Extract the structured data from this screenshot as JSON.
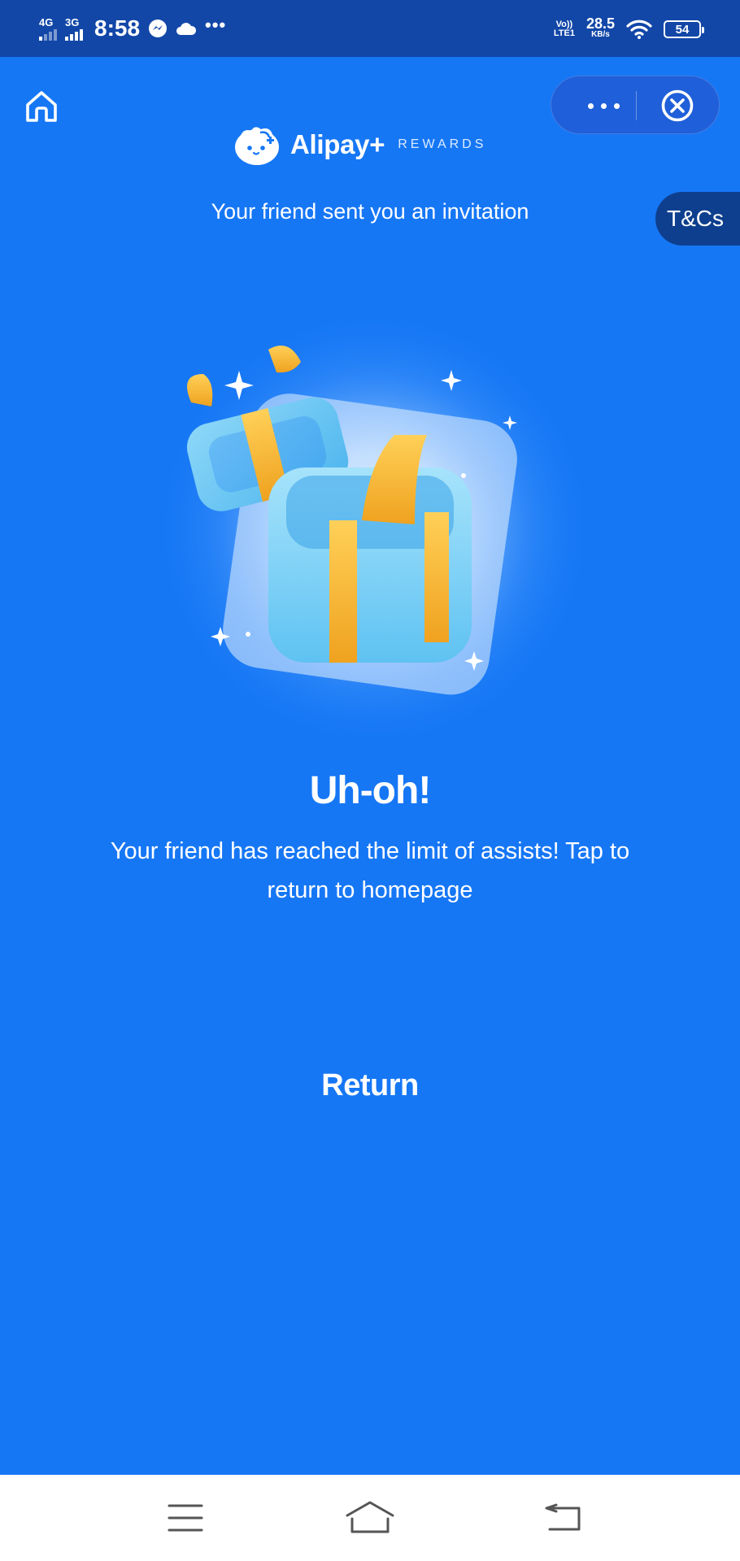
{
  "status_bar": {
    "net1": "4G",
    "net2": "3G",
    "time": "8:58",
    "volte_top": "Vo))",
    "volte_bottom": "LTE1",
    "speed_value": "28.5",
    "speed_unit": "KB/s",
    "battery": "54",
    "icons": [
      "messenger-icon",
      "cloud-icon",
      "more-dots",
      "wifi-icon",
      "battery-icon"
    ]
  },
  "header": {
    "logo_name": "Alipay+",
    "logo_tag": "REWARDS",
    "invite_text": "Your friend sent you an invitation",
    "tcs_label": "T&Cs"
  },
  "main": {
    "title": "Uh-oh!",
    "message": "Your friend has reached the limit of assists! Tap to return to homepage",
    "return_label": "Return"
  },
  "colors": {
    "background": "#1677F5",
    "status_bar": "#1247A8",
    "tcs_tab": "#0E3F8E",
    "gift_box": "#7FD3F7",
    "ribbon": "#F5B731"
  }
}
